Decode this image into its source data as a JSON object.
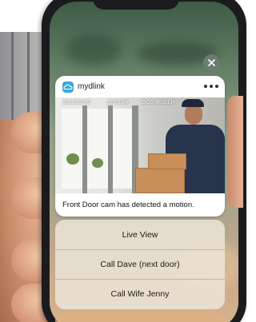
{
  "notification": {
    "app_name": "mydlink",
    "app_icon": "cloud-icon",
    "more_icon": "more-dots-icon",
    "close_icon": "close-icon",
    "media": {
      "date": "2020/03/20",
      "time": "16:03:54",
      "camera_id": "DCS-8630LH"
    },
    "message": "Front Door cam has detected a motion."
  },
  "actions": [
    {
      "label": "Live View"
    },
    {
      "label": "Call Dave (next door)"
    },
    {
      "label": "Call Wife Jenny"
    }
  ],
  "colors": {
    "app_icon": "#3aa8dc",
    "card_bg": "#ffffff",
    "action_panel_bg": "#eee8dc"
  }
}
